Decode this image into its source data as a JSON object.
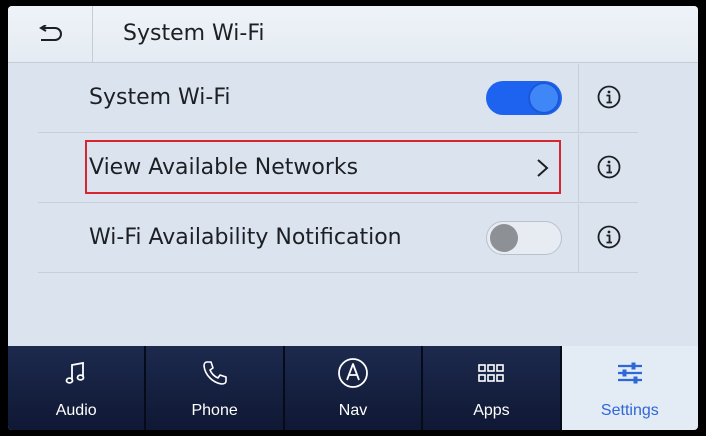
{
  "header": {
    "title": "System Wi-Fi",
    "back_icon": "back-arrow-icon"
  },
  "rows": [
    {
      "label": "System Wi-Fi",
      "control": "toggle",
      "toggle_on": true
    },
    {
      "label": "View Available Networks",
      "control": "chevron",
      "highlighted": true
    },
    {
      "label": "Wi-Fi Availability Notification",
      "control": "toggle",
      "toggle_on": false
    }
  ],
  "tabs": [
    {
      "label": "Audio",
      "icon": "music-note-icon",
      "active": false
    },
    {
      "label": "Phone",
      "icon": "phone-icon",
      "active": false
    },
    {
      "label": "Nav",
      "icon": "navigation-icon",
      "active": false
    },
    {
      "label": "Apps",
      "icon": "apps-grid-icon",
      "active": false
    },
    {
      "label": "Settings",
      "icon": "settings-sliders-icon",
      "active": true
    }
  ],
  "colors": {
    "accent": "#1e63f0",
    "highlight_border": "#d7262e",
    "tabbar": "#16213f",
    "active_tab_label": "#2f66d8"
  }
}
